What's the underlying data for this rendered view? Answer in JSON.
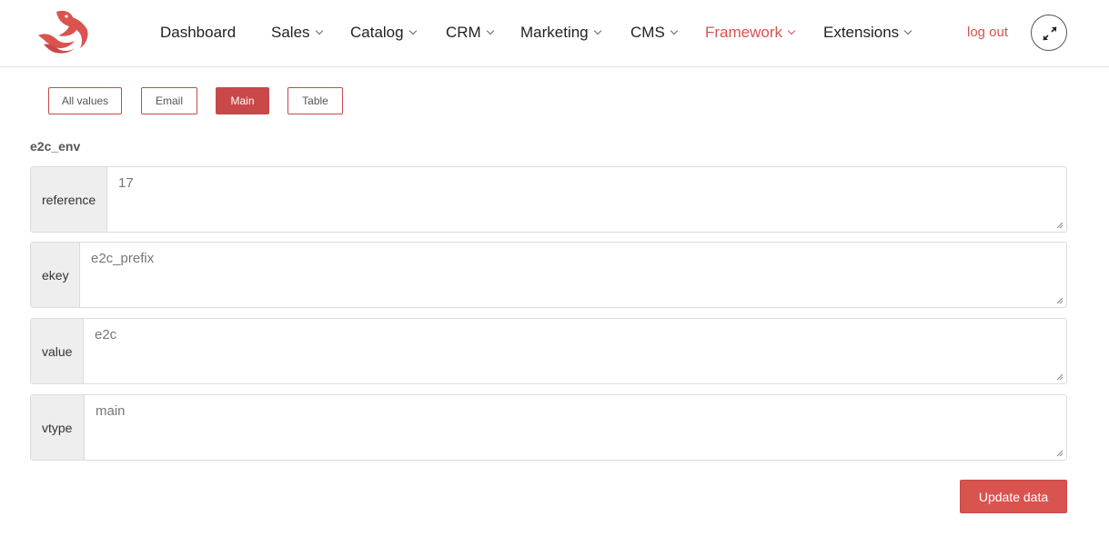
{
  "nav": {
    "items": [
      {
        "label": "Dashboard"
      },
      {
        "label": "Sales"
      },
      {
        "label": "Catalog"
      },
      {
        "label": "CRM"
      },
      {
        "label": "Marketing"
      },
      {
        "label": "CMS"
      },
      {
        "label": "Framework",
        "active": true
      },
      {
        "label": "Extensions"
      }
    ],
    "logout_label": "log out",
    "logo_icon": "fish-logo-icon",
    "expand_icon": "expand-arrows-icon"
  },
  "tabs": [
    {
      "label": "All values"
    },
    {
      "label": "Email"
    },
    {
      "label": "Main",
      "active": true
    },
    {
      "label": "Table"
    }
  ],
  "section_title": "e2c_env",
  "fields": [
    {
      "label": "reference",
      "value": "17"
    },
    {
      "label": "ekey",
      "value": "e2c_prefix"
    },
    {
      "label": "value",
      "value": "e2c"
    },
    {
      "label": "vtype",
      "value": "main"
    }
  ],
  "update_label": "Update data",
  "colors": {
    "accent": "#d9534f",
    "accent_dark": "#c9484a"
  }
}
